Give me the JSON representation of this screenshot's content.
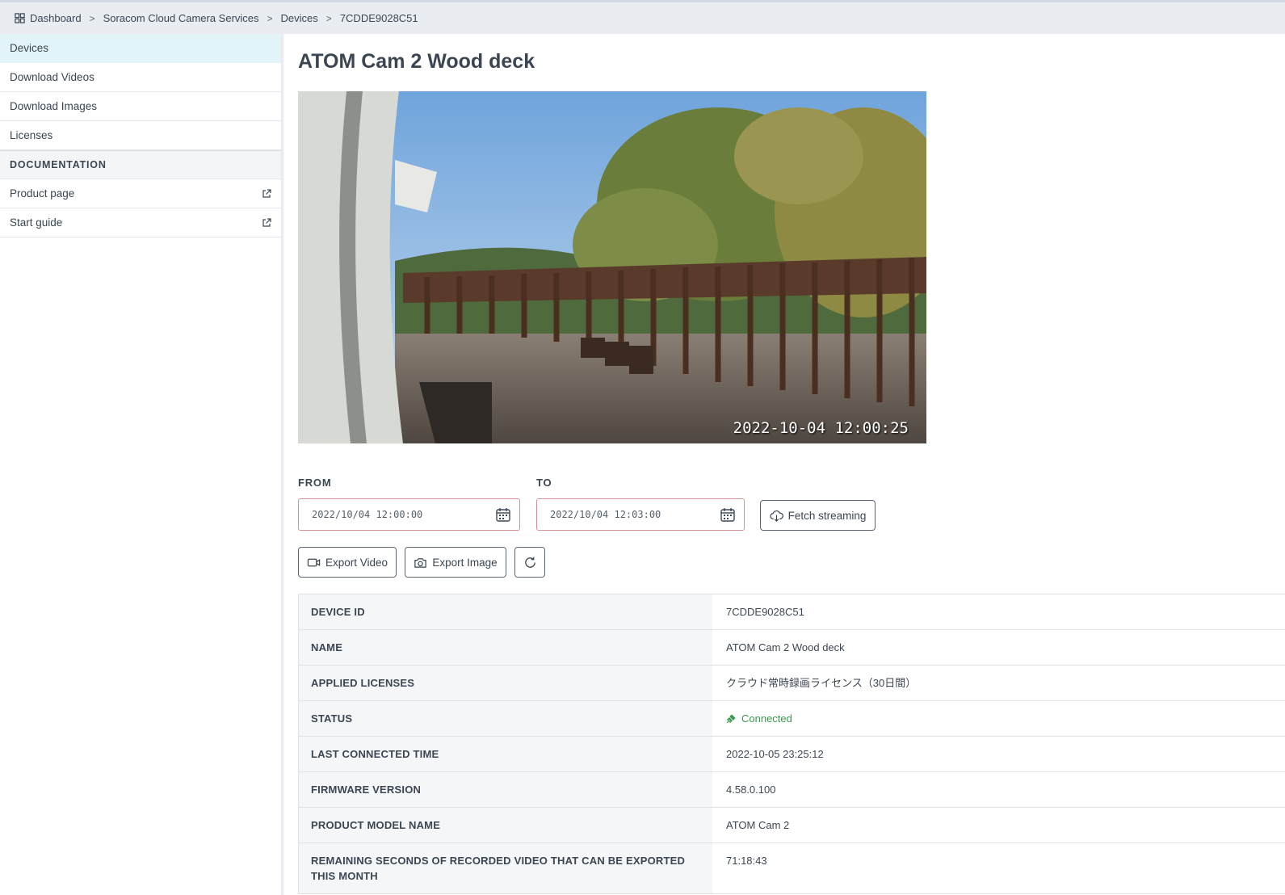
{
  "breadcrumb": {
    "items": [
      "Dashboard",
      "Soracom Cloud Camera Services",
      "Devices",
      "7CDDE9028C51"
    ]
  },
  "sidebar": {
    "items": [
      {
        "label": "Devices",
        "active": true
      },
      {
        "label": "Download Videos"
      },
      {
        "label": "Download Images"
      },
      {
        "label": "Licenses"
      }
    ],
    "section_title": "DOCUMENTATION",
    "doc_links": [
      {
        "label": "Product page"
      },
      {
        "label": "Start guide"
      }
    ]
  },
  "page": {
    "title": "ATOM Cam 2 Wood deck",
    "camera_timestamp": "2022-10-04  12:00:25"
  },
  "range": {
    "from_label": "FROM",
    "from_value": "2022/10/04 12:00:00",
    "to_label": "TO",
    "to_value": "2022/10/04 12:03:00",
    "fetch_label": "Fetch streaming"
  },
  "actions": {
    "export_video": "Export Video",
    "export_image": "Export Image"
  },
  "details": [
    {
      "key": "DEVICE ID",
      "value": "7CDDE9028C51"
    },
    {
      "key": "NAME",
      "value": "ATOM Cam 2 Wood deck"
    },
    {
      "key": "APPLIED LICENSES",
      "value": "クラウド常時録画ライセンス（30日間）"
    },
    {
      "key": "STATUS",
      "value": "Connected"
    },
    {
      "key": "LAST CONNECTED TIME",
      "value": "2022-10-05 23:25:12"
    },
    {
      "key": "FIRMWARE VERSION",
      "value": "4.58.0.100"
    },
    {
      "key": "PRODUCT MODEL NAME",
      "value": "ATOM Cam 2"
    },
    {
      "key": "REMAINING SECONDS OF RECORDED VIDEO THAT CAN BE EXPORTED THIS MONTH",
      "value": "71:18:43"
    }
  ],
  "colors": {
    "accent_active": "#e3f4f8",
    "status_connected": "#3a9a4b",
    "date_border": "#d98f96"
  }
}
